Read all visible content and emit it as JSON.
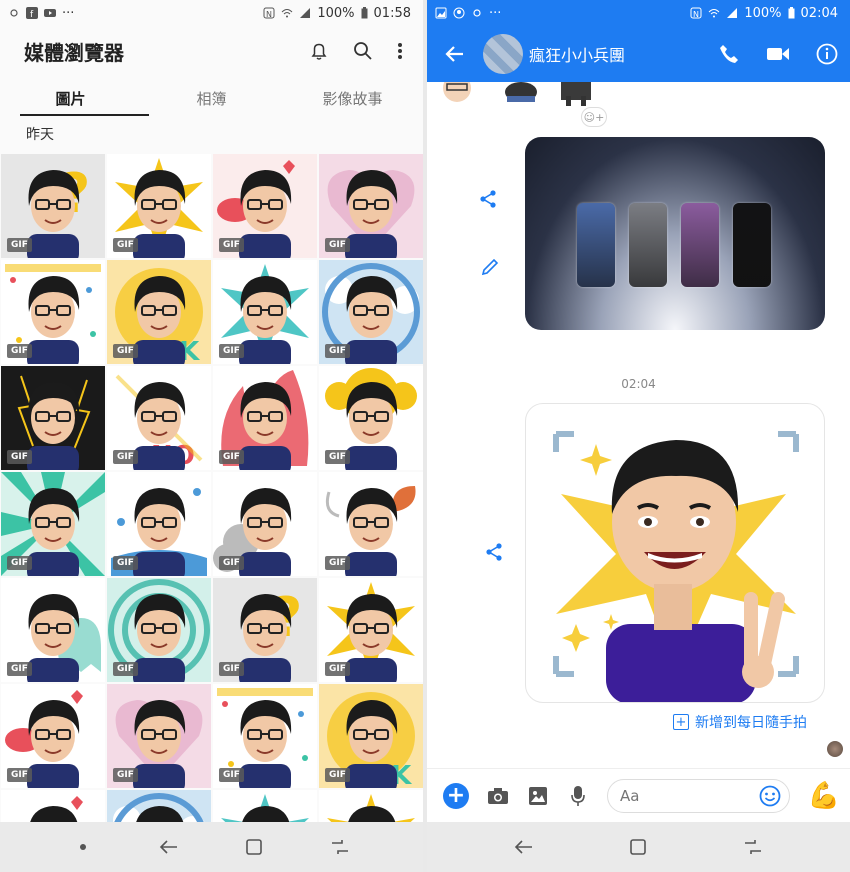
{
  "left": {
    "status": {
      "time": "01:58",
      "battery": "100%"
    },
    "header": {
      "title": "媒體瀏覽器"
    },
    "tabs": [
      {
        "label": "圖片",
        "active": true
      },
      {
        "label": "相簿",
        "active": false
      },
      {
        "label": "影像故事",
        "active": false
      }
    ],
    "date_label": "昨天",
    "gif_label": "GIF",
    "grid_items": [
      {
        "bg": "#e6e6e6",
        "accent": "#f5c51a",
        "shape": "question",
        "gif": true
      },
      {
        "bg": "#ffffff",
        "accent": "#f5c51a",
        "shape": "burst",
        "gif": true
      },
      {
        "bg": "#fbecec",
        "accent": "#e8505b",
        "shape": "kiss",
        "gif": true
      },
      {
        "bg": "#f4dbe6",
        "accent": "#e9b9d1",
        "shape": "heart",
        "gif": true
      },
      {
        "bg": "#ffffff",
        "accent": "#f5c51a",
        "shape": "confetti",
        "gif": true
      },
      {
        "bg": "#fbe4a6",
        "accent": "#f5c51a",
        "shape": "ok",
        "gif": true
      },
      {
        "bg": "#ffffff",
        "accent": "#4fc6c5",
        "shape": "burst",
        "gif": true
      },
      {
        "bg": "#cfe4f3",
        "accent": "#5b9bd5",
        "shape": "cloud",
        "gif": true
      },
      {
        "bg": "#1a1a1a",
        "accent": "#f5c51a",
        "shape": "lightning",
        "gif": true
      },
      {
        "bg": "#ffffff",
        "accent": "#e8505b",
        "shape": "no",
        "gif": true
      },
      {
        "bg": "#ffffff",
        "accent": "#e8505b",
        "shape": "fire",
        "gif": true
      },
      {
        "bg": "#ffffff",
        "accent": "#f5c51a",
        "shape": "sun",
        "gif": true
      },
      {
        "bg": "#d8f2eb",
        "accent": "#3cc3a5",
        "shape": "rays",
        "gif": true
      },
      {
        "bg": "#ffffff",
        "accent": "#4c9ad8",
        "shape": "water",
        "gif": true
      },
      {
        "bg": "#ffffff",
        "accent": "#bbbbbb",
        "shape": "steam",
        "gif": true
      },
      {
        "bg": "#ffffff",
        "accent": "#e0703a",
        "shape": "leaf",
        "gif": true
      },
      {
        "bg": "#ffffff",
        "accent": "#7fd3c6",
        "shape": "ghost",
        "gif": true
      },
      {
        "bg": "#d3f0ea",
        "accent": "#57c1b2",
        "shape": "spiral",
        "gif": true
      },
      {
        "bg": "#e6e6e6",
        "accent": "#f5c51a",
        "shape": "question",
        "gif": true
      },
      {
        "bg": "#ffffff",
        "accent": "#f5c51a",
        "shape": "burst",
        "gif": true
      },
      {
        "bg": "#ffffff",
        "accent": "#e8505b",
        "shape": "kiss",
        "gif": true
      },
      {
        "bg": "#f4dbe6",
        "accent": "#e9b9d1",
        "shape": "heart",
        "gif": true
      },
      {
        "bg": "#ffffff",
        "accent": "#f5c51a",
        "shape": "confetti",
        "gif": true
      },
      {
        "bg": "#fbe4a6",
        "accent": "#f5c51a",
        "shape": "ok",
        "gif": true
      },
      {
        "bg": "#ffffff",
        "accent": "#e8505b",
        "shape": "kiss",
        "gif": false
      },
      {
        "bg": "#cfe4f3",
        "accent": "#5b9bd5",
        "shape": "cloud",
        "gif": false
      },
      {
        "bg": "#ffffff",
        "accent": "#4fc6c5",
        "shape": "burst",
        "gif": false
      },
      {
        "bg": "#ffffff",
        "accent": "#f5c51a",
        "shape": "burst",
        "gif": false
      }
    ]
  },
  "right": {
    "status": {
      "time": "02:04",
      "battery": "100%"
    },
    "header": {
      "title": "瘋狂小小兵團"
    },
    "timestamp": "02:04",
    "react_label": "☺+",
    "add_daily": "新增到每日隨手拍",
    "composer": {
      "placeholder": "Aa"
    },
    "phones": [
      "#4a6aa8",
      "#7b7d83",
      "#8b5c9e",
      "#121214"
    ]
  },
  "colors": {
    "messenger_blue": "#1e7cf2"
  }
}
